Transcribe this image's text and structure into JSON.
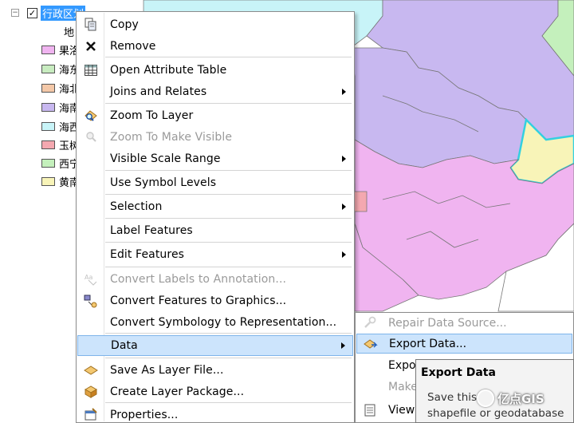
{
  "toc": {
    "layer_name": "行政区划",
    "group_label": "地",
    "legend": [
      {
        "label": "果洛",
        "color": "#f0b4f0"
      },
      {
        "label": "海东",
        "color": "#c8ecc0"
      },
      {
        "label": "海北",
        "color": "#f4c8a8"
      },
      {
        "label": "海南",
        "color": "#c8b8f0"
      },
      {
        "label": "海西",
        "color": "#c8f4f8"
      },
      {
        "label": "玉树",
        "color": "#f4a8b0"
      },
      {
        "label": "西宁",
        "color": "#c4f0bc"
      },
      {
        "label": "黄南",
        "color": "#f8f4b8"
      }
    ]
  },
  "menu": {
    "items": [
      {
        "label": "Copy",
        "icon": "copy-icon"
      },
      {
        "label": "Remove",
        "icon": "remove-icon"
      },
      {
        "label": "Open Attribute Table",
        "icon": "table-icon"
      },
      {
        "label": "Joins and Relates",
        "icon": ""
      },
      {
        "label": "Zoom To Layer",
        "icon": "zoom-layer-icon"
      },
      {
        "label": "Zoom To Make Visible",
        "icon": "zoom-visible-icon"
      },
      {
        "label": "Visible Scale Range",
        "icon": ""
      },
      {
        "label": "Use Symbol Levels",
        "icon": ""
      },
      {
        "label": "Selection",
        "icon": ""
      },
      {
        "label": "Label Features",
        "icon": ""
      },
      {
        "label": "Edit Features",
        "icon": ""
      },
      {
        "label": "Convert Labels to Annotation...",
        "icon": "convert-labels-icon"
      },
      {
        "label": "Convert Features to Graphics...",
        "icon": "convert-features-icon"
      },
      {
        "label": "Convert Symbology to Representation...",
        "icon": ""
      },
      {
        "label": "Data",
        "icon": ""
      },
      {
        "label": "Save As Layer File...",
        "icon": "layer-file-icon"
      },
      {
        "label": "Create Layer Package...",
        "icon": "layer-package-icon"
      },
      {
        "label": "Properties...",
        "icon": "properties-icon"
      }
    ]
  },
  "submenu": {
    "items": [
      {
        "label": "Repair Data Source..."
      },
      {
        "label": "Export Data..."
      },
      {
        "label": "Expo"
      },
      {
        "label": "Make"
      },
      {
        "label": "View"
      }
    ]
  },
  "tooltip": {
    "title": "Export Data",
    "line1": "Save this ",
    "line2": "shapefile or geodatabase"
  },
  "watermark": "亿点GIS",
  "colors": {
    "highlight": "#cce4fc",
    "highlight_border": "#7eb4ea",
    "selection_blue": "#3399ff",
    "region_pink": "#f0b4f0",
    "region_purple": "#c8b8f0",
    "region_cyan": "#c8f4f8",
    "region_yellow": "#f8f4b8",
    "region_green": "#c8ecc0"
  }
}
